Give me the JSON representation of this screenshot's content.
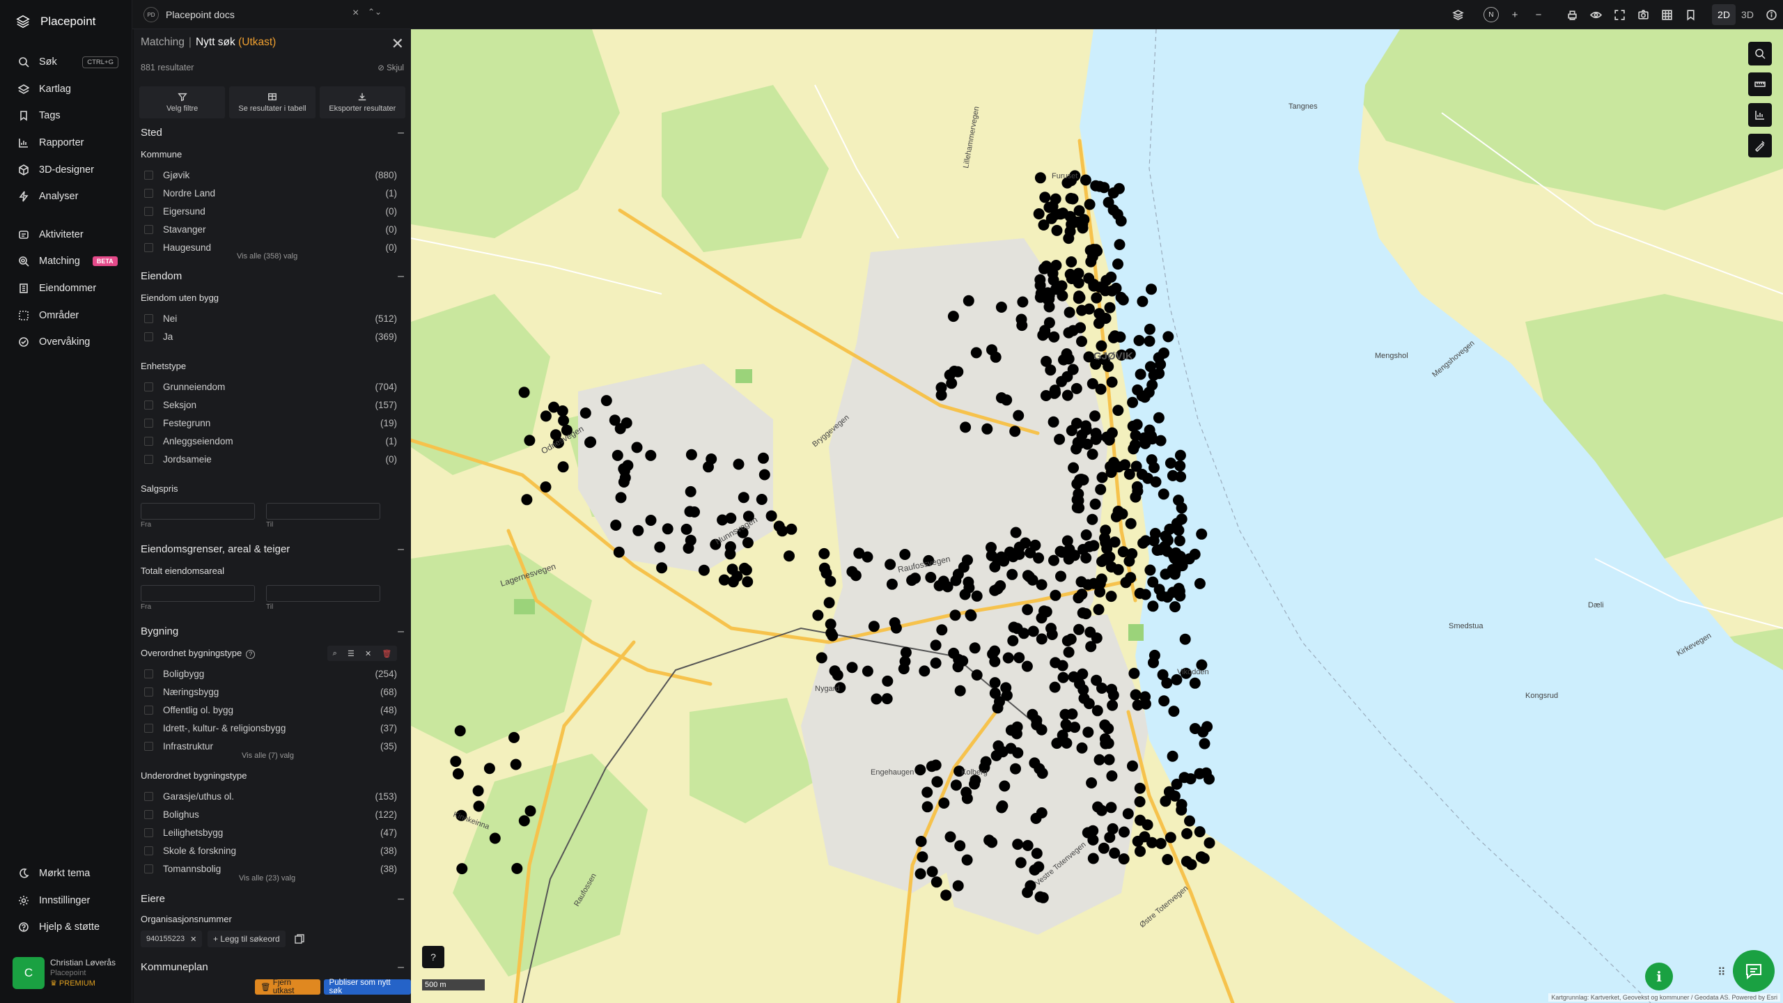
{
  "app": {
    "name": "Placepoint"
  },
  "nav": {
    "items": [
      {
        "label": "Søk",
        "shortcut": "CTRL+G",
        "icon": "search-icon"
      },
      {
        "label": "Kartlag",
        "icon": "layers-icon"
      },
      {
        "label": "Tags",
        "icon": "bookmark-icon"
      },
      {
        "label": "Rapporter",
        "icon": "chart-icon"
      },
      {
        "label": "3D-designer",
        "icon": "cube-icon"
      },
      {
        "label": "Analyser",
        "icon": "bolt-icon"
      }
    ],
    "items2": [
      {
        "label": "Aktiviteter",
        "icon": "activity-icon"
      },
      {
        "label": "Matching",
        "badge": "BETA",
        "icon": "matching-icon"
      },
      {
        "label": "Eiendommer",
        "icon": "building-icon"
      },
      {
        "label": "Områder",
        "icon": "area-icon"
      },
      {
        "label": "Overvåking",
        "icon": "monitor-icon"
      }
    ],
    "bottom": [
      {
        "label": "Mørkt tema",
        "icon": "moon-icon"
      },
      {
        "label": "Innstillinger",
        "icon": "gear-icon"
      },
      {
        "label": "Hjelp & støtte",
        "icon": "help-icon"
      }
    ]
  },
  "user": {
    "initial": "C",
    "name": "Christian Løverås",
    "org": "Placepoint",
    "tier": "PREMIUM"
  },
  "topbar": {
    "doc_badge": "PD",
    "doc_name": "Placepoint docs",
    "mode_2d": "2D",
    "mode_3d": "3D",
    "north": "N"
  },
  "panel": {
    "crumb": "Matching",
    "title": "Nytt søk",
    "draft": "(Utkast)",
    "results": "881 resultater",
    "hide": "Skjul",
    "actions": [
      "Velg filtre",
      "Se resultater i tabell",
      "Eksporter resultater"
    ],
    "sted": {
      "title": "Sted",
      "kommune_label": "Kommune",
      "rows": [
        {
          "label": "Gjøvik",
          "count": "(880)"
        },
        {
          "label": "Nordre Land",
          "count": "(1)"
        },
        {
          "label": "Eigersund",
          "count": "(0)"
        },
        {
          "label": "Stavanger",
          "count": "(0)"
        },
        {
          "label": "Haugesund",
          "count": "(0)"
        }
      ],
      "show_all": "Vis alle (358) valg"
    },
    "eiendom": {
      "title": "Eiendom",
      "uten_bygg_label": "Eiendom uten bygg",
      "uten_bygg": [
        {
          "label": "Nei",
          "count": "(512)"
        },
        {
          "label": "Ja",
          "count": "(369)"
        }
      ],
      "enhetstype_label": "Enhetstype",
      "enhetstype": [
        {
          "label": "Grunneiendom",
          "count": "(704)"
        },
        {
          "label": "Seksjon",
          "count": "(157)"
        },
        {
          "label": "Festegrunn",
          "count": "(19)"
        },
        {
          "label": "Anleggseiendom",
          "count": "(1)"
        },
        {
          "label": "Jordsameie",
          "count": "(0)"
        }
      ],
      "salgspris_label": "Salgspris",
      "from": "Fra",
      "to": "Til"
    },
    "grenser": {
      "title": "Eiendomsgrenser, areal & teiger",
      "areal_label": "Totalt eiendomsareal",
      "from": "Fra",
      "to": "Til"
    },
    "bygning": {
      "title": "Bygning",
      "overordnet_label": "Overordnet bygningstype",
      "overordnet": [
        {
          "label": "Boligbygg",
          "count": "(254)"
        },
        {
          "label": "Næringsbygg",
          "count": "(68)"
        },
        {
          "label": "Offentlig ol. bygg",
          "count": "(48)"
        },
        {
          "label": "Idrett-, kultur- & religionsbygg",
          "count": "(37)"
        },
        {
          "label": "Infrastruktur",
          "count": "(35)"
        }
      ],
      "overordnet_show_all": "Vis alle (7) valg",
      "underordnet_label": "Underordnet bygningstype",
      "underordnet": [
        {
          "label": "Garasje/uthus ol.",
          "count": "(153)"
        },
        {
          "label": "Bolighus",
          "count": "(122)"
        },
        {
          "label": "Leilighetsbygg",
          "count": "(47)"
        },
        {
          "label": "Skole & forskning",
          "count": "(38)"
        },
        {
          "label": "Tomannsbolig",
          "count": "(38)"
        }
      ],
      "underordnet_show_all": "Vis alle (23) valg"
    },
    "eiere": {
      "title": "Eiere",
      "org_label": "Organisasjonsnummer",
      "org_chip": "940155223",
      "add_keyword": "Legg til søkeord"
    },
    "kommuneplan": {
      "title": "Kommuneplan"
    },
    "remove_draft": "Fjern utkast",
    "publish": "Publiser som nytt søk"
  },
  "map": {
    "labels": {
      "city": "GJØVIK",
      "raufossvegen": "Raufossvegen",
      "odnesvegen": "Odnesvegen",
      "lagernesvegen": "Lagernesvegen",
      "hunnsvegen": "Hunnsvegen",
      "bryggevegen": "Bryggevegen",
      "nygard": "Nygard",
      "kolberg": "Kolberg",
      "vikodden": "Vikodden",
      "furuset": "Furuset",
      "tangnes": "Tangnes",
      "mengshol": "Mengshol",
      "kinnkeinna": "Kinnkeinna",
      "raufossen": "Raufossen",
      "ostre_totenvegen": "Østre Totenvegen",
      "vestre_totenvegen": "Vestre Totenvegen",
      "mengshovegen": "Mengshovegen",
      "kirkevegen": "Kirkevegen",
      "lillehammervegen": "Lillehammervegen",
      "smedstua": "Smedstua",
      "daeli": "Dæli",
      "engehaugen": "Engehaugen",
      "kongsrud": "Kongsrud"
    },
    "scale": "500 m",
    "attribution": "Kartgrunnlag: Kartverket, Geovekst og kommuner / Geodata AS. Powered by Esri",
    "colors": {
      "water": "#cdeefd",
      "land": "#f4f1c0",
      "forest": "#c8e69c",
      "urban": "#e4e4e4",
      "road": "#f5c24a",
      "point": "#000000",
      "accent": "#1aa142"
    }
  }
}
